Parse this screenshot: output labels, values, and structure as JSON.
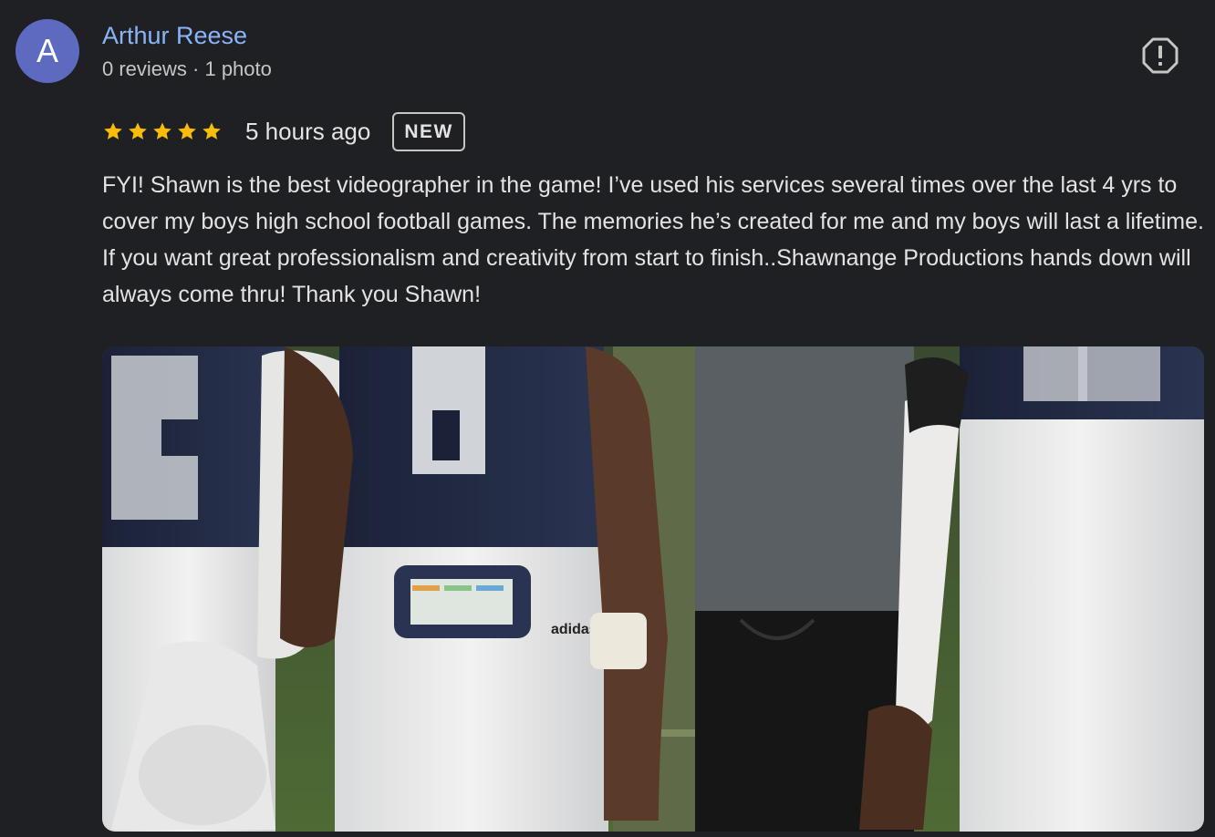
{
  "review": {
    "avatar_letter": "A",
    "author_name": "Arthur Reese",
    "author_meta": "0 reviews · 1 photo",
    "rating": 5,
    "rating_max": 5,
    "time_ago": "5 hours ago",
    "badge": "NEW",
    "text": "FYI! Shawn is the best videographer in the game! I’ve used his services several times over the last 4 yrs to cover my boys high school football games. The memories he’s created for me and my boys will last a lifetime. If you want great professionalism and creativity from start to finish..Shawnange Productions hands down will always come thru! Thank you Shawn!",
    "photo_logo_text": "adidas"
  },
  "colors": {
    "background": "#1f2024",
    "avatar": "#5c6bc0",
    "author_link": "#8ab4f8",
    "star": "#fbbc04",
    "text": "#e3e3e3",
    "secondary_text": "#c4c7c5"
  },
  "icons": {
    "report": "report-flag-icon",
    "star": "star-icon"
  }
}
